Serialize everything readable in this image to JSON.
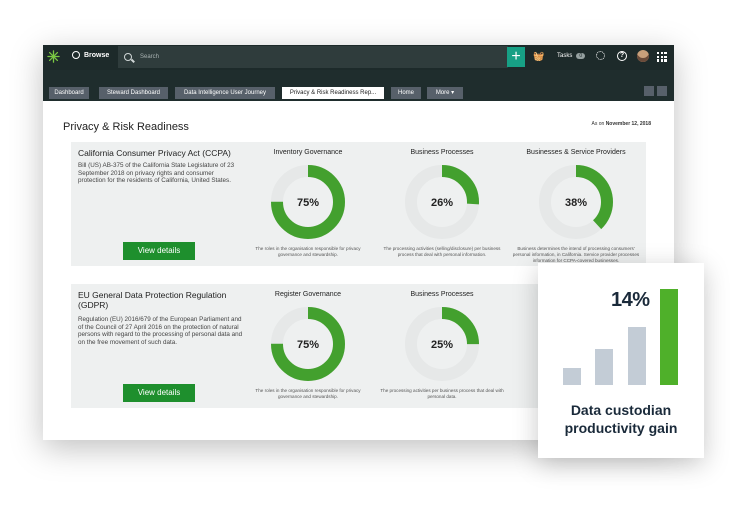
{
  "topbar": {
    "browse_label": "Browse",
    "search_placeholder": "Search",
    "plus_label": "+",
    "tasks_label": "Tasks",
    "tasks_count": "0",
    "help_label": "?"
  },
  "tabs": [
    {
      "label": "Dashboard"
    },
    {
      "label": "Steward Dashboard"
    },
    {
      "label": "Data Intelligence User Journey"
    },
    {
      "label": "Privacy & Risk Readiness Rep..."
    },
    {
      "label": "Home"
    },
    {
      "label": "More ▾"
    }
  ],
  "page": {
    "title": "Privacy & Risk Readiness",
    "as_of_label": "As on",
    "as_of_date": "November 12, 2018"
  },
  "cards": [
    {
      "title": "California Consumer Privacy Act (CCPA)",
      "description": "Bill (US) AB-375 of the California State Legislature of 23 September 2018 on privacy rights and consumer protection for the residents of California, United States.",
      "button": "View details",
      "metrics": [
        {
          "title": "Inventory Governance",
          "value": 75,
          "label": "75%",
          "desc": "The roles in the organisation responsible for privacy governance and stewardship."
        },
        {
          "title": "Business Processes",
          "value": 26,
          "label": "26%",
          "desc": "The processing activities (selling/disclosure) per business process that deal with personal information."
        },
        {
          "title": "Businesses & Service Providers",
          "value": 38,
          "label": "38%",
          "desc": "Business determines the intend of processing consumers' personal information, in California. Service provider processes information for CCPA-covered businesses."
        }
      ]
    },
    {
      "title": "EU General Data Protection Regulation (GDPR)",
      "description": "Regulation (EU) 2016/679 of the European Parliament and of the Council of 27 April 2016 on the protection of natural persons with regard to the processing of personal data and on the free movement of such data.",
      "button": "View details",
      "metrics": [
        {
          "title": "Register Governance",
          "value": 75,
          "label": "75%",
          "desc": "The roles in the organisation responsible for privacy governance and stewardship."
        },
        {
          "title": "Business Processes",
          "value": 25,
          "label": "25%",
          "desc": "The processing activities per business process that deal with personal data."
        }
      ]
    }
  ],
  "popup": {
    "value": "14%",
    "caption": "Data custodian productivity gain",
    "bars": [
      0.18,
      0.37,
      0.6,
      1.0
    ]
  },
  "colors": {
    "ring_fill": "#43a02e",
    "ring_track": "#e6e8e8",
    "button": "#1e8f2d",
    "topbar": "#1d2a2a",
    "accent_plus": "#17a085"
  }
}
